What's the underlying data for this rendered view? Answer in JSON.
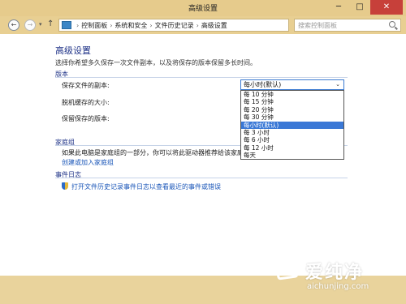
{
  "window": {
    "title": "高级设置",
    "minimize": "─",
    "maximize": "□",
    "close": "✕"
  },
  "nav": {
    "back": "←",
    "forward": "→",
    "dropdown": "▾",
    "up": "↑"
  },
  "address": {
    "crumbs": [
      "控制面板",
      "系统和安全",
      "文件历史记录",
      "高级设置"
    ],
    "separator": "›",
    "dropdown": "▾",
    "refresh": "↻"
  },
  "search": {
    "placeholder": "搜索控制面板"
  },
  "main": {
    "title": "高级设置",
    "description": "选择你希望多久保存一次文件副本，以及将保存的版本保留多长时间。",
    "versions": {
      "heading": "版本",
      "save_copies_label": "保存文件的副本:",
      "offline_cache_label": "脱机缓存的大小:",
      "keep_versions_label": "保留保存的版本:",
      "selected_value": "每小时(默认)",
      "select_arrow": "⌄",
      "options": [
        "每 10 分钟",
        "每 15 分钟",
        "每 20 分钟",
        "每 30 分钟",
        "每小时(默认)",
        "每 3 小时",
        "每 6 小时",
        "每 12 小时",
        "每天"
      ],
      "selected_index": 4
    },
    "homegroup": {
      "heading": "家庭组",
      "text": "如果此电脑是家庭组的一部分，你可以将此驱动器推荐给该家庭组",
      "link": "创建或加入家庭组"
    },
    "eventlog": {
      "heading": "事件日志",
      "link": "打开文件历史记录事件日志以查看最近的事件或错误"
    }
  },
  "watermark": {
    "cn": "爱纯净",
    "en": "aichunjing.com"
  }
}
